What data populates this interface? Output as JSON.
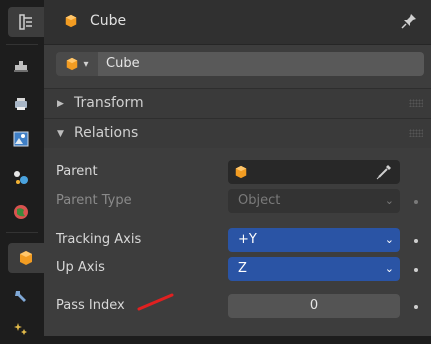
{
  "header": {
    "object_name": "Cube"
  },
  "datablock": {
    "name": "Cube"
  },
  "panels": {
    "transform": "Transform",
    "relations": "Relations"
  },
  "relations": {
    "parent_label": "Parent",
    "parent_type_label": "Parent Type",
    "parent_type_value": "Object",
    "tracking_axis_label": "Tracking Axis",
    "tracking_axis_value": "+Y",
    "up_axis_label": "Up Axis",
    "up_axis_value": "Z",
    "pass_index_label": "Pass Index",
    "pass_index_value": "0"
  },
  "colors": {
    "accent_blue": "#2a54a5",
    "annotation_red": "#e02020",
    "object_orange": "#f29c22"
  },
  "icons": [
    "tool-settings-icon",
    "render-icon",
    "output-icon",
    "view-layer-icon",
    "scene-icon",
    "world-icon",
    "object-icon",
    "modifier-icon",
    "particles-icon",
    "cube-icon",
    "pin-icon",
    "eyedropper-icon",
    "chevron-down-icon"
  ]
}
